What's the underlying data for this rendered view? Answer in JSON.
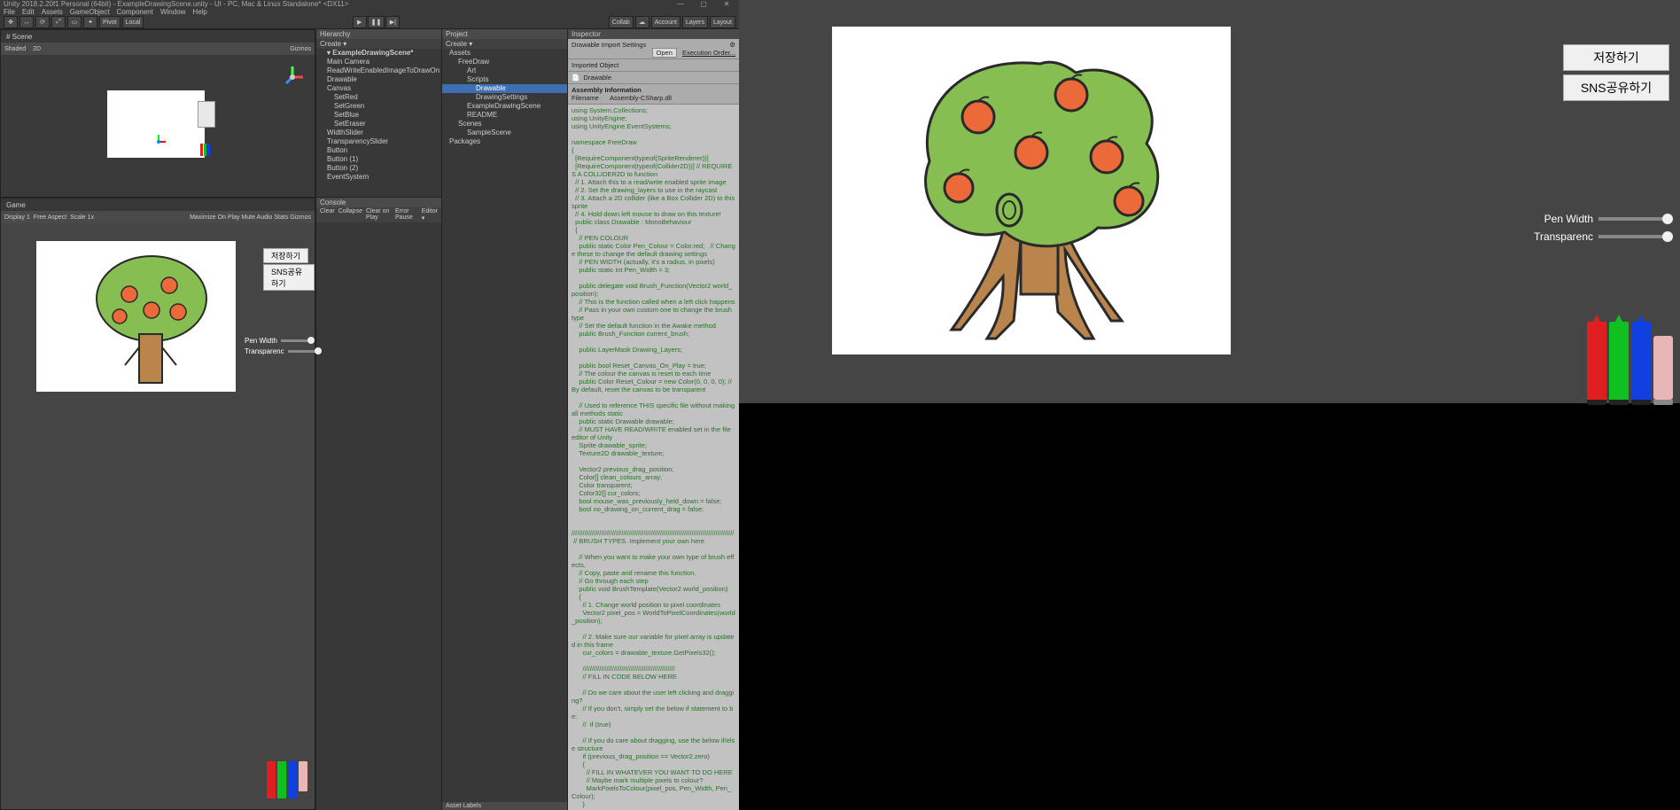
{
  "titlebar": "Unity 2018.2.20f1 Personal (64bit) - ExampleDrawingScene.unity - UI - PC, Mac & Linux Standalone* <DX11>",
  "menus": [
    "File",
    "Edit",
    "Assets",
    "GameObject",
    "Component",
    "Window",
    "Help"
  ],
  "toolbar_right": [
    "Collab",
    "Account",
    "Layers",
    "Layout"
  ],
  "play_icons": [
    "▶",
    "❚❚",
    "▶|"
  ],
  "scene_tabs": [
    "# Scene"
  ],
  "scene_toolbar": {
    "shaded": "Shaded",
    "mode": "2D",
    "gizmos": "Gizmos"
  },
  "game_tabs": [
    "Game"
  ],
  "game_toolbar": {
    "display": "Display 1",
    "aspect": "Free Aspect",
    "scale": "Scale 1x",
    "right": "Maximize On Play  Mute Audio  Stats  Gizmos"
  },
  "hierarchy": {
    "title": "Hierarchy",
    "create": "Create ▾",
    "scene": "ExampleDrawingScene*",
    "items": [
      "Main Camera",
      "ReadWriteEnabledImageToDrawOn",
      "Drawable",
      "Canvas",
      "  SetRed",
      "  SetGreen",
      "  SetBlue",
      "  SetEraser",
      "WidthSlider",
      "TransparencySlider",
      "Button",
      "Button (1)",
      "Button (2)",
      "EventSystem"
    ]
  },
  "console": {
    "title": "Console",
    "buttons": [
      "Clear",
      "Collapse",
      "Clear on Play",
      "Error Pause",
      "Editor ▾"
    ]
  },
  "project": {
    "title": "Project",
    "create": "Create ▾",
    "items": [
      {
        "l": "Assets",
        "lv": 0
      },
      {
        "l": "FreeDraw",
        "lv": 1
      },
      {
        "l": "Art",
        "lv": 2
      },
      {
        "l": "Scripts",
        "lv": 2
      },
      {
        "l": "Drawable",
        "lv": 3,
        "sel": true
      },
      {
        "l": "DrawingSettings",
        "lv": 3
      },
      {
        "l": "ExampleDrawingScene",
        "lv": 2
      },
      {
        "l": "README",
        "lv": 2
      },
      {
        "l": "Scenes",
        "lv": 1
      },
      {
        "l": "SampleScene",
        "lv": 2
      },
      {
        "l": "Packages",
        "lv": 0
      }
    ],
    "asset_labels": "Asset Labels"
  },
  "inspector": {
    "title": "Inspector",
    "import_title": "Drawable Import Settings",
    "open_btn": "Open",
    "exec_order": "Execution Order...",
    "imported_object": "Imported Object",
    "script_name": "Drawable",
    "asm_info": "Assembly Information",
    "filename_lbl": "Filename",
    "filename_val": "Assembly-CSharp.dll",
    "code": "using System.Collections;\nusing UnityEngine;\nusing UnityEngine.EventSystems;\n\nnamespace FreeDraw\n{\n  [RequireComponent(typeof(SpriteRenderer))]\n  [RequireComponent(typeof(Collider2D))] // REQUIRES A COLLIDER2D to function\n  // 1. Attach this to a read/write enabled sprite image\n  // 2. Set the drawing_layers to use in the raycast\n  // 3. Attach a 2D collider (like a Box Collider 2D) to this sprite\n  // 4. Hold down left mouse to draw on this texture!\n  public class Drawable : MonoBehaviour\n  {\n    // PEN COLOUR\n    public static Color Pen_Colour = Color.red;   // Change these to change the default drawing settings\n    // PEN WIDTH (actually, it's a radius, in pixels)\n    public static int Pen_Width = 3;\n\n    public delegate void Brush_Function(Vector2 world_position);\n    // This is the function called when a left click happens\n    // Pass in your own custom one to change the brush type\n    // Set the default function in the Awake method\n    public Brush_Function current_brush;\n\n    public LayerMask Drawing_Layers;\n\n    public bool Reset_Canvas_On_Play = true;\n    // The colour the canvas is reset to each time\n    public Color Reset_Colour = new Color(0, 0, 0, 0); // By default, reset the canvas to be transparent\n\n    // Used to reference THIS specific file without making all methods static\n    public static Drawable drawable;\n    // MUST HAVE READ/WRITE enabled set in the file editor of Unity\n    Sprite drawable_sprite;\n    Texture2D drawable_texture;\n\n    Vector2 previous_drag_position;\n    Color[] clean_colours_array;\n    Color transparent;\n    Color32[] cur_colors;\n    bool mouse_was_previously_held_down = false;\n    bool no_drawing_on_current_drag = false;\n\n ////////////////////////////////////////////////////////////////////////////////////////\n // BRUSH TYPES. Implement your own here\n\n    // When you want to make your own type of brush effects,\n    // Copy, paste and rename this function.\n    // Go through each step\n    public void BrushTemplate(Vector2 world_position)\n    {\n      // 1. Change world position to pixel coordinates\n      Vector2 pixel_pos = WorldToPixelCoordinates(world_position);\n\n      // 2. Make sure our variable for pixel array is updated in this frame\n      cur_colors = drawable_texture.GetPixels32();\n\n      //////////////////////////////////////////////////\n      // FILL IN CODE BELOW HERE\n\n      // Do we care about the user left clicking and dragging?\n      // If you don't, simply set the below if statement to be:\n      //  if (true)\n\n      // If you do care about dragging, use the below if/else structure\n      if (previous_drag_position == Vector2.zero)\n      {\n        // FILL IN WHATEVER YOU WANT TO DO HERE\n        // Maybe mark multiple pixels to colour?\n        MarkPixelsToColour(pixel_pos, Pen_Width, Pen_Colour);\n      }"
  },
  "app": {
    "save_btn": "저장하기",
    "share_btn": "SNS공유하기",
    "pen_width": "Pen Width",
    "transparency": "Transparenc"
  },
  "colors": {
    "red": "#e02020",
    "green": "#10c020",
    "blue": "#1040e0"
  }
}
